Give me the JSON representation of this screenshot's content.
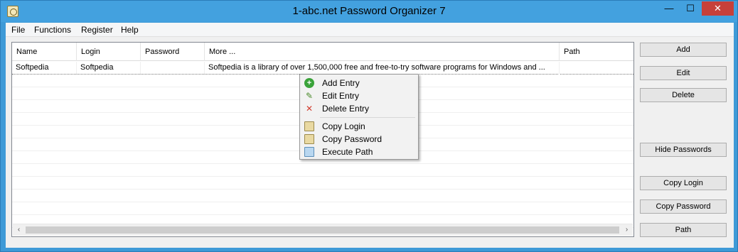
{
  "window": {
    "title": "1-abc.net Password Organizer 7",
    "minimize_glyph": "—",
    "maximize_glyph": "☐",
    "close_glyph": "✕"
  },
  "menubar": {
    "items": [
      "File",
      "Functions",
      "Register",
      "Help"
    ]
  },
  "list": {
    "columns": [
      "Name",
      "Login",
      "Password",
      "More ...",
      "Path"
    ],
    "rows": [
      {
        "name": "Softpedia",
        "login": "Softpedia",
        "password": "",
        "more": "Softpedia is a library of over 1,500,000 free and free-to-try software programs for Windows and ...",
        "path": ""
      }
    ],
    "scroll_left_glyph": "‹",
    "scroll_right_glyph": "›"
  },
  "side_buttons": [
    "Add",
    "Edit",
    "Delete",
    "Hide Passwords",
    "Copy Login",
    "Copy Password",
    "Path"
  ],
  "context_menu": {
    "items": [
      {
        "label": "Add Entry",
        "icon": "add-icon"
      },
      {
        "label": "Edit Entry",
        "icon": "edit-icon"
      },
      {
        "label": "Delete Entry",
        "icon": "delete-icon"
      },
      {
        "label": "Copy Login",
        "icon": "copy-icon"
      },
      {
        "label": "Copy Password",
        "icon": "copy-icon"
      },
      {
        "label": "Execute Path",
        "icon": "execute-icon"
      }
    ]
  },
  "colors": {
    "window_frame": "#3e9ad7",
    "close_button": "#c7403a",
    "client_bg": "#f0f0f0"
  }
}
